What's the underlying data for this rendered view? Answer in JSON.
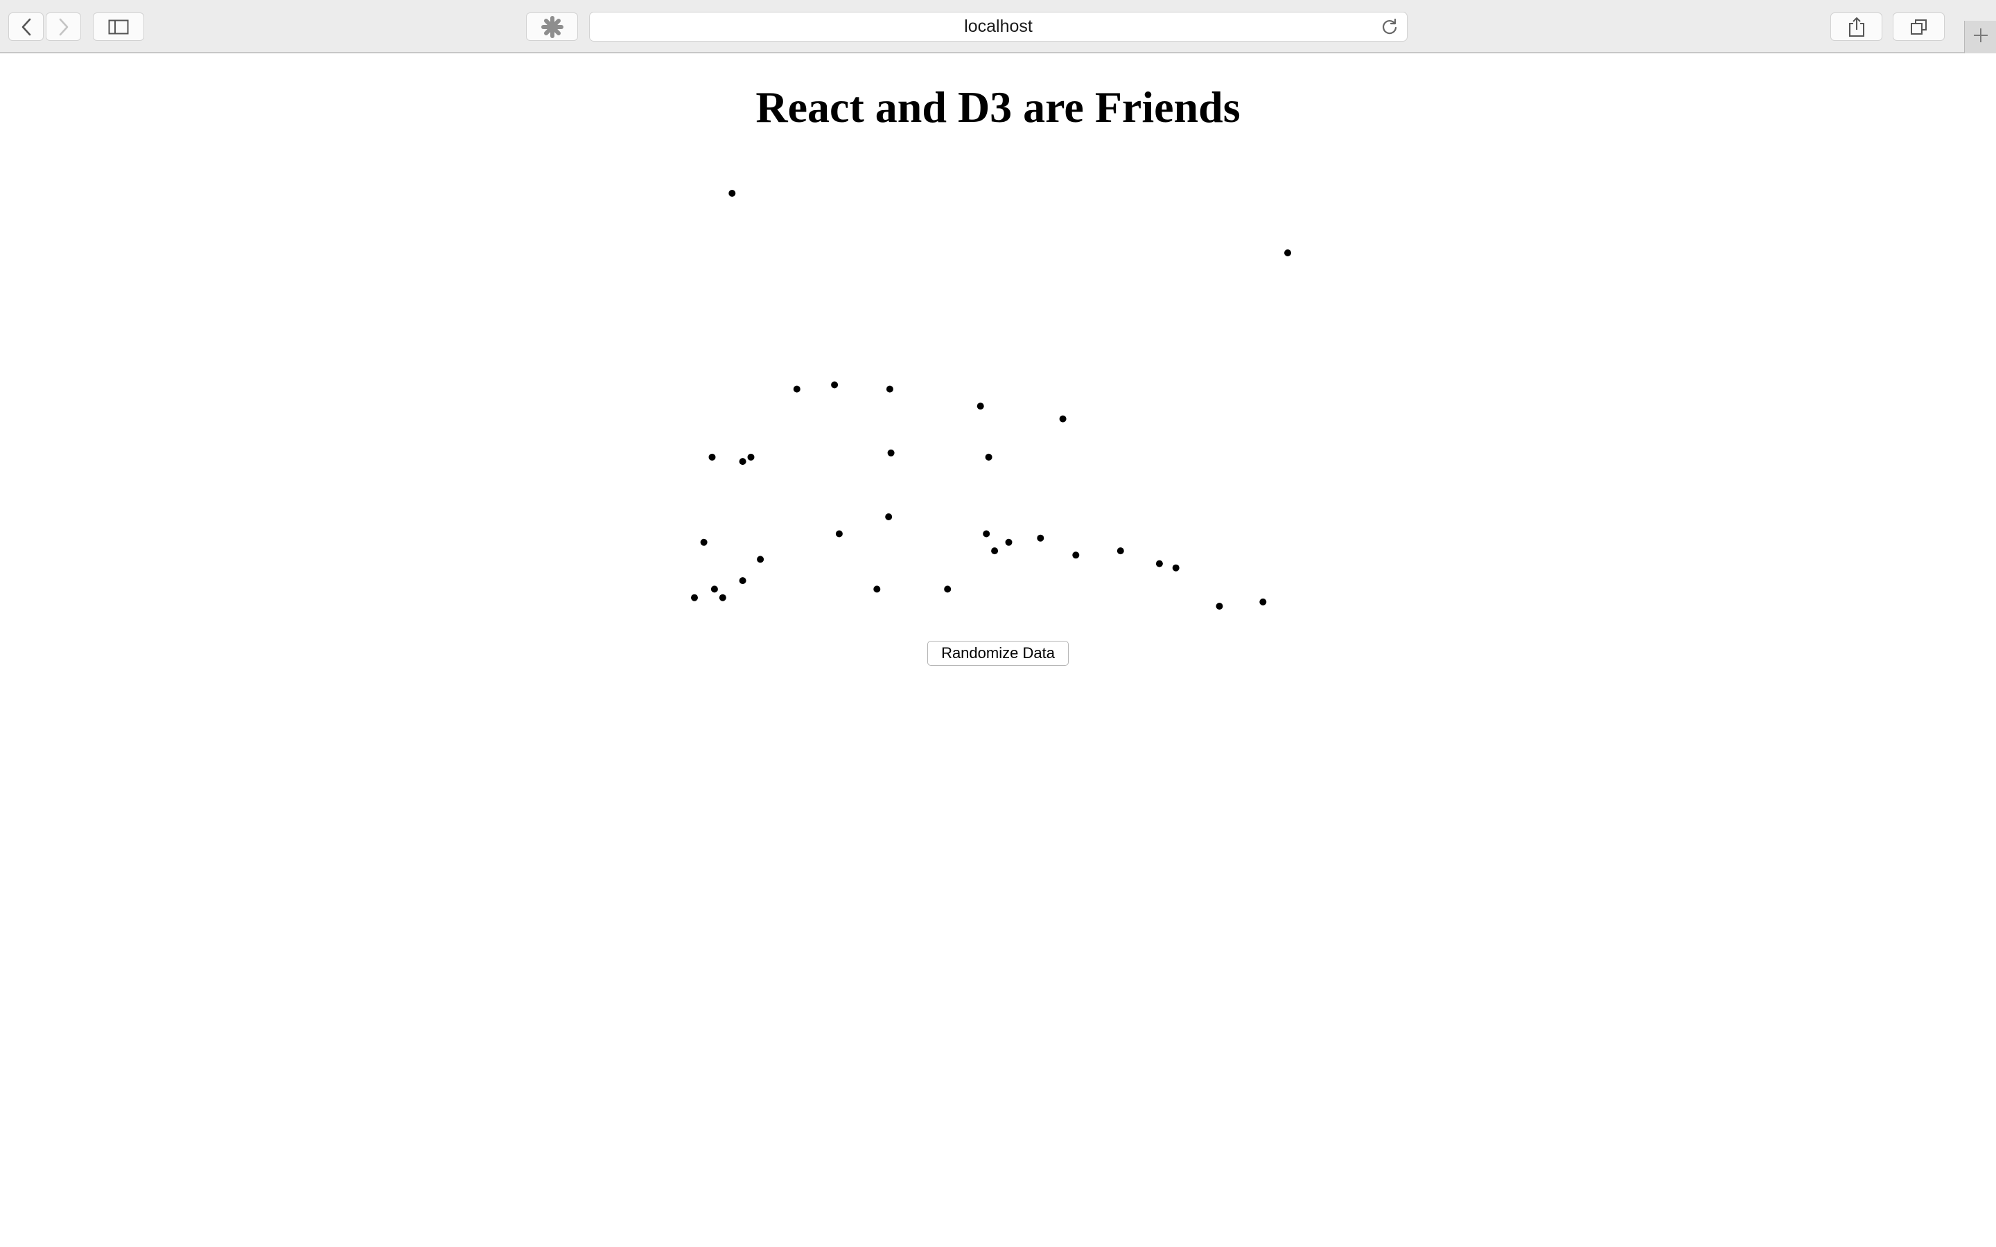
{
  "browser": {
    "address": "localhost",
    "icons": {
      "back": "chevron-left-icon",
      "forward": "chevron-right-icon",
      "sidebar": "sidebar-icon",
      "extension": "puzzle-icon",
      "reload": "reload-icon",
      "share": "share-icon",
      "tabs": "tabs-icon",
      "new_tab": "plus-icon"
    }
  },
  "page": {
    "title": "React and D3 are Friends",
    "button_label": "Randomize Data"
  },
  "chart_data": {
    "type": "scatter",
    "title": "",
    "xlabel": "",
    "ylabel": "",
    "grid": false,
    "axes_visible": false,
    "point_color": "#000000",
    "points": [
      [
        39,
        98
      ],
      [
        511,
        84
      ],
      [
        94,
        52
      ],
      [
        126,
        53
      ],
      [
        173,
        52
      ],
      [
        250,
        48
      ],
      [
        320,
        45
      ],
      [
        22,
        36
      ],
      [
        55,
        36
      ],
      [
        48,
        35
      ],
      [
        174,
        37
      ],
      [
        257,
        36
      ],
      [
        172,
        22
      ],
      [
        274,
        16
      ],
      [
        301,
        17
      ],
      [
        15,
        16
      ],
      [
        130,
        18
      ],
      [
        262,
        14
      ],
      [
        63,
        12
      ],
      [
        255,
        18
      ],
      [
        331,
        13
      ],
      [
        369,
        14
      ],
      [
        402,
        11
      ],
      [
        453,
        1
      ],
      [
        7,
        3
      ],
      [
        24,
        5
      ],
      [
        48,
        7
      ],
      [
        31,
        3
      ],
      [
        162,
        5
      ],
      [
        222,
        5
      ],
      [
        416,
        10
      ],
      [
        490,
        2
      ]
    ]
  }
}
